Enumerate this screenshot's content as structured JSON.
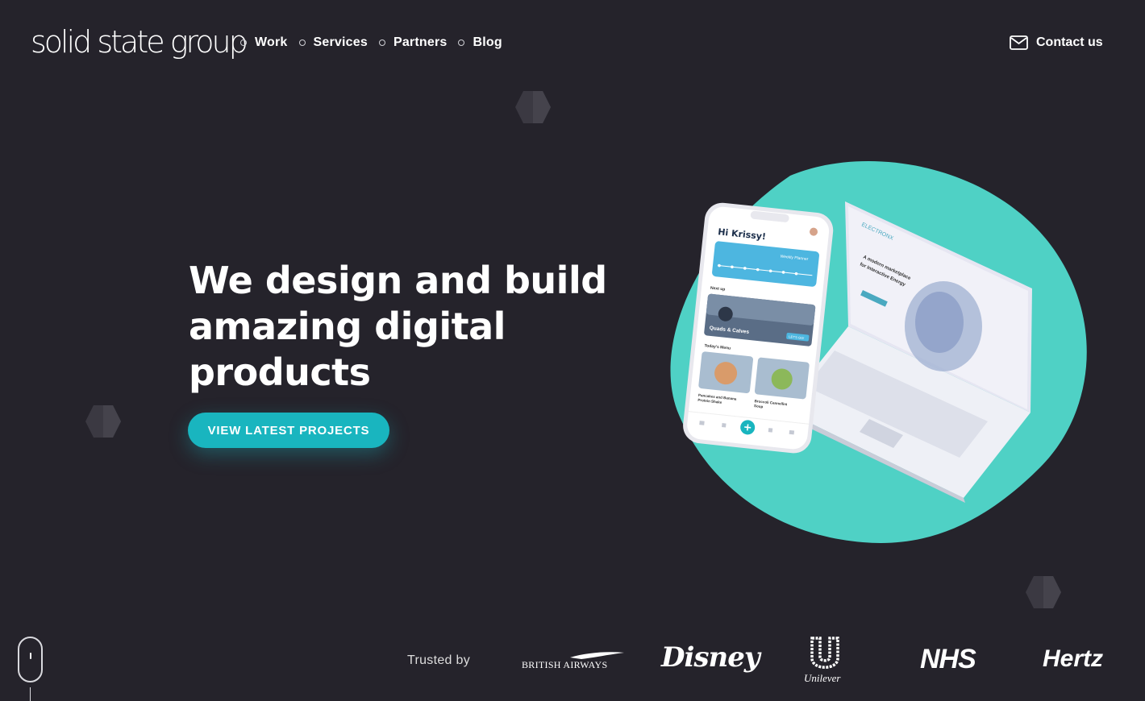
{
  "header": {
    "logo_text": "solid state group",
    "nav": [
      {
        "label": "Work"
      },
      {
        "label": "Services"
      },
      {
        "label": "Partners"
      },
      {
        "label": "Blog"
      }
    ],
    "contact_label": "Contact us"
  },
  "hero": {
    "title_line1": "We design and build",
    "title_line2": "amazing digital",
    "title_line3": "products",
    "cta_label": "VIEW LATEST PROJECTS"
  },
  "mockup": {
    "phone_greeting": "Hi Krissy!",
    "planner_label": "Weekly Planner",
    "next_up_label": "Next up",
    "workout_label": "Quads & Calves",
    "go_label": "LET'S GO!",
    "menu_label": "Today's Menu",
    "meal1_line1": "Pancakes and Banana",
    "meal1_line2": "Protein Shake",
    "meal2_line1": "Broccoli Cannellini",
    "meal2_line2": "Soup",
    "laptop_brand": "ELECTRONX",
    "laptop_headline_line1": "A modern marketplace",
    "laptop_headline_line2": "for Interactive Energy"
  },
  "trusted": {
    "label": "Trusted by",
    "brands": [
      "BRITISH AIRWAYS",
      "Disney",
      "Unilever",
      "NHS",
      "Hertz"
    ]
  },
  "colors": {
    "background": "#25232b",
    "accent": "#19b5bf",
    "blob": "#4fd1c5"
  }
}
